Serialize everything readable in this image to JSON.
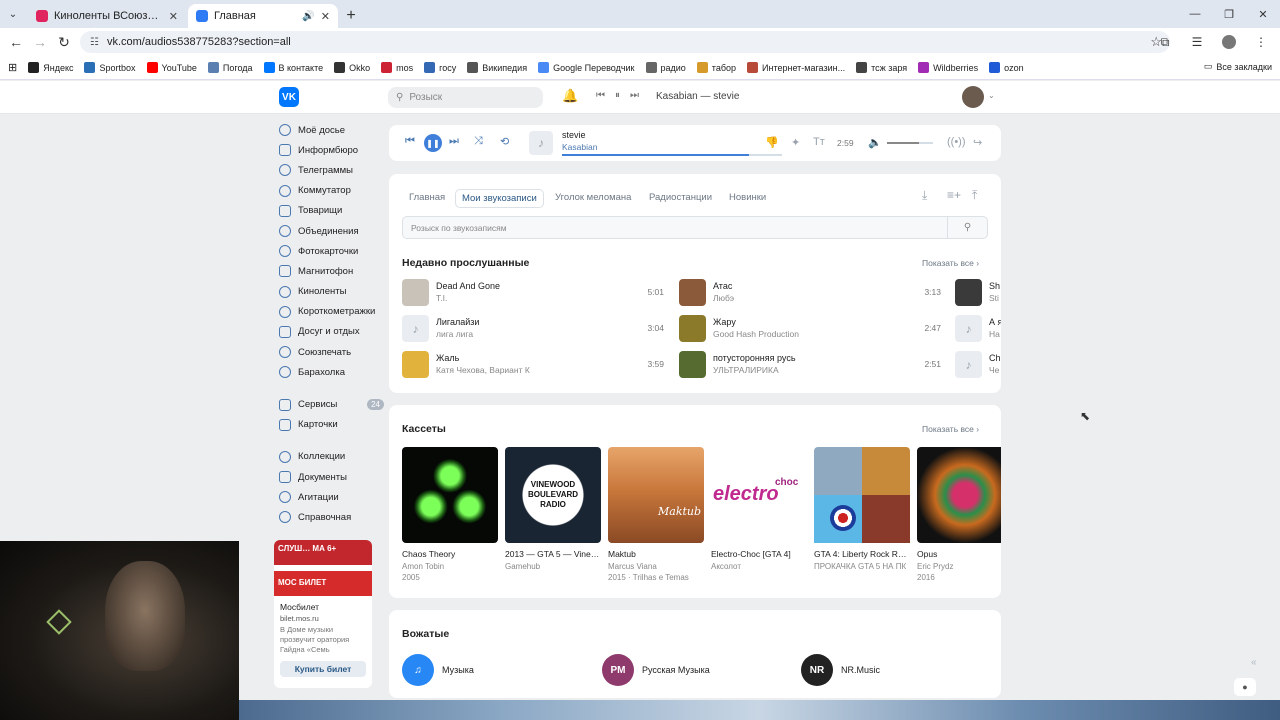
{
  "browser": {
    "tabs": [
      {
        "label": "Киноленты ВСоюзе — смотре",
        "active": false,
        "color": "#e0245e"
      },
      {
        "label": "Главная",
        "active": true,
        "color": "#2f7bf5"
      }
    ],
    "url": "vk.com/audios538775283?section=all",
    "bookmarks": [
      {
        "label": "Яндекс",
        "color": "#222222"
      },
      {
        "label": "Sportbox",
        "color": "#2a6fb5"
      },
      {
        "label": "YouTube",
        "color": "#ff0000"
      },
      {
        "label": "Погода",
        "color": "#5a7fb0"
      },
      {
        "label": "В контакте",
        "color": "#0077ff"
      },
      {
        "label": "Okko",
        "color": "#333333"
      },
      {
        "label": "mos",
        "color": "#cc2233"
      },
      {
        "label": "госу",
        "color": "#3568b4"
      },
      {
        "label": "Википедия",
        "color": "#555555"
      },
      {
        "label": "Google Переводчик",
        "color": "#4a8af4"
      },
      {
        "label": "радио",
        "color": "#666666"
      },
      {
        "label": "табор",
        "color": "#d69a2a"
      },
      {
        "label": "Интернет-магазин...",
        "color": "#b84a3a"
      },
      {
        "label": "тсж заря",
        "color": "#444444"
      },
      {
        "label": "Wildberries",
        "color": "#a12bb5"
      },
      {
        "label": "ozon",
        "color": "#1f5bd6"
      }
    ],
    "all_bookmarks": "Все закладки"
  },
  "vk": {
    "logo": "VK",
    "search_placeholder": "Розыск",
    "mini_player_title": "Kasabian — stevie"
  },
  "nav": {
    "group1": [
      "Моё досье",
      "Информбюро",
      "Телеграммы",
      "Коммутатор",
      "Товарищи",
      "Объединения",
      "Фотокарточки",
      "Магнитофон",
      "Киноленты",
      "Короткометражки",
      "Досуг и отдых",
      "Союзпечать",
      "Барахолка"
    ],
    "group2": [
      {
        "label": "Сервисы",
        "badge": "24"
      },
      {
        "label": "Карточки",
        "badge": ""
      }
    ],
    "group3": [
      "Коллекции",
      "Документы",
      "Агитации",
      "Справочная"
    ]
  },
  "ad": {
    "banner_top": "СЛУШ… МА 6+",
    "banner_bottom": "МОС БИЛЕТ",
    "title": "Мосбилет",
    "url": "bilet.mos.ru",
    "text": "В Доме музыки прозвучит оратория Гайдна «Семь",
    "button": "Купить билет"
  },
  "player": {
    "title": "stevie",
    "artist": "Kasabian",
    "time": "2:59",
    "progress": 0.85,
    "volume": 0.7
  },
  "music": {
    "tabs": [
      "Главная",
      "Мои звукозаписи",
      "Уголок меломана",
      "Радиостанции",
      "Новинки"
    ],
    "selected_tab": 1,
    "search_placeholder": "Розыск по звукозаписям",
    "recent_title": "Недавно прослушанные",
    "show_all": "Показать все",
    "recent": [
      {
        "title": "Dead And Gone",
        "artist": "T.I.",
        "duration": "5:01",
        "cover": "#c9c2b8"
      },
      {
        "title": "Лигалайзи",
        "artist": "лига лига",
        "duration": "3:04",
        "cover": ""
      },
      {
        "title": "Жаль",
        "artist": "Катя Чехова, Вариант К",
        "duration": "3:59",
        "cover": "#e2b33c"
      },
      {
        "title": "Атас",
        "artist": "Любэ",
        "duration": "3:13",
        "cover": "#8a5a3a"
      },
      {
        "title": "Жару",
        "artist": "Good Hash Production",
        "duration": "2:47",
        "cover": "#8a7a2a"
      },
      {
        "title": "потусторонняя русь",
        "artist": "УЛЬТРАЛИРИКА",
        "duration": "2:51",
        "cover": "#556b2f"
      },
      {
        "title": "Sh",
        "artist": "Sti",
        "duration": "",
        "cover": "#3a3a3a"
      },
      {
        "title": "А я",
        "artist": "На",
        "duration": "",
        "cover": ""
      },
      {
        "title": "Ch",
        "artist": "Че",
        "duration": "",
        "cover": ""
      }
    ]
  },
  "cassettes": {
    "title": "Кассеты",
    "show_all": "Показать все",
    "items": [
      {
        "title": "Chaos Theory",
        "artist": "Amon Tobin",
        "year": "2005"
      },
      {
        "title": "2013 — GTA 5 — Vinewood Boulevard Radio",
        "artist": "Gamehub",
        "year": ""
      },
      {
        "title": "Maktub",
        "artist": "Marcus Viana",
        "year": "2015 · Trilhas e Temas"
      },
      {
        "title": "Electro-Choc [GTA 4]",
        "artist": "Аксолот",
        "year": ""
      },
      {
        "title": "GTA 4: Liberty Rock Radio",
        "artist": "ПРОКАЧКА GTA 5 НА ПК",
        "year": ""
      },
      {
        "title": "Opus",
        "artist": "Eric Prydz",
        "year": "2016"
      }
    ],
    "art_text": {
      "vinewood": "VINEWOOD BOULEVARD RADIO",
      "maktub": "Maktub",
      "electro": "electro",
      "choc": "choc"
    }
  },
  "curated": {
    "title": "Вожатые",
    "items": [
      {
        "label": "Музыка",
        "icon": "music-note-icon",
        "color": "#2787f5",
        "mark": "♫"
      },
      {
        "label": "Русская Музыка",
        "icon": "rm-logo-icon",
        "color": "#8e3a6d",
        "mark": "PM"
      },
      {
        "label": "NR.Music",
        "icon": "nr-logo-icon",
        "color": "#222222",
        "mark": "NR"
      }
    ]
  }
}
